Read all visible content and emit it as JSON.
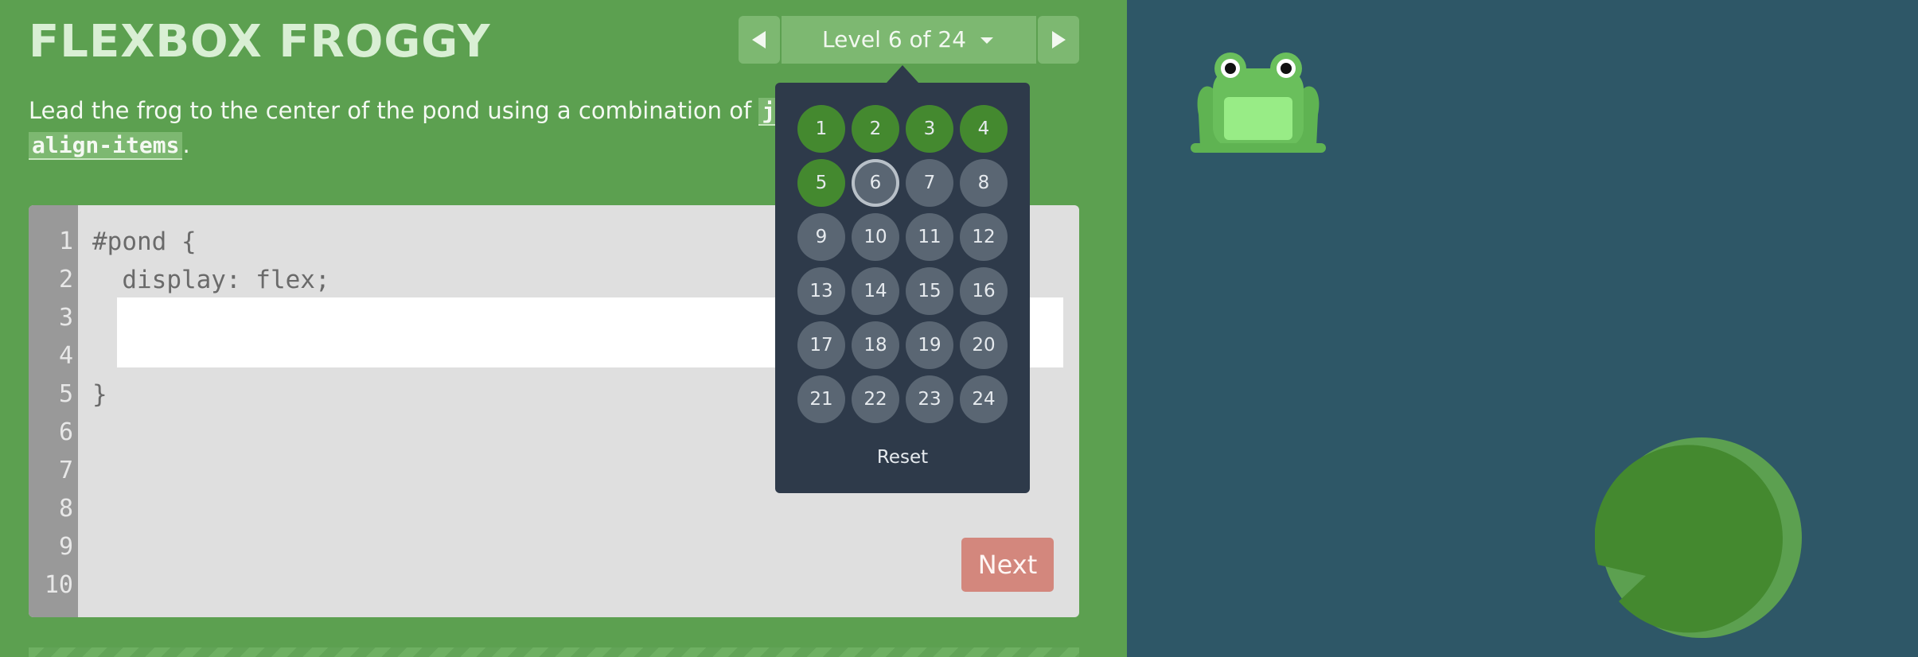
{
  "app": {
    "title": "FLEXBOX FROGGY"
  },
  "level_nav": {
    "prev_icon": "triangle-left-icon",
    "current_label": "Level 6 of 24",
    "dropdown_icon": "caret-down-icon",
    "next_icon": "triangle-right-icon"
  },
  "instructions": {
    "text_before": "Lead the frog to the center of the pond using a combination of ",
    "keyword_1": "justify",
    "keyword_2": "align-items",
    "text_after": "."
  },
  "editor": {
    "line_numbers": [
      "1",
      "2",
      "3",
      "4",
      "5",
      "6",
      "7",
      "8",
      "9",
      "10"
    ],
    "code": {
      "line_1": "#pond {",
      "line_2": "  display: flex;",
      "line_5": "}"
    },
    "input_value": "",
    "next_label": "Next"
  },
  "level_menu": {
    "levels": [
      "1",
      "2",
      "3",
      "4",
      "5",
      "6",
      "7",
      "8",
      "9",
      "10",
      "11",
      "12",
      "13",
      "14",
      "15",
      "16",
      "17",
      "18",
      "19",
      "20",
      "21",
      "22",
      "23",
      "24"
    ],
    "solved": [
      "1",
      "2",
      "3",
      "4",
      "5"
    ],
    "current": "6",
    "reset_label": "Reset"
  },
  "colors": {
    "left_bg": "#5ca050",
    "pond_bg": "#2e5767",
    "solved": "#44892f",
    "unsolved": "#5a6673",
    "next_button": "#d3877d",
    "frog": "#6abf5c",
    "lilypad": "#44892f"
  },
  "pond": {
    "frog_icon": "frog-icon",
    "lilypad_icon": "lilypad-icon"
  }
}
